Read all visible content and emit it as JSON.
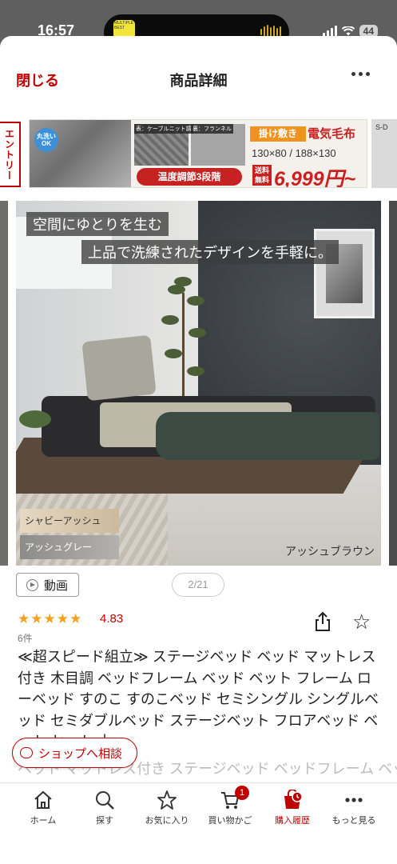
{
  "status_bar": {
    "time": "16:57",
    "battery": "44",
    "island_app_label": "MULTIPLE BEST"
  },
  "header": {
    "close_label": "閉じる",
    "title": "商品詳細"
  },
  "banner": {
    "entry_label": "エントリー",
    "wash_badge": "丸洗いOK",
    "tag_front": "表：ケーブルニット調",
    "tag_back": "裏：フランネル",
    "temp_label": "温度調節3段階",
    "heat_label": "掛け敷き",
    "product_label": "電気毛布",
    "size_label": "130×80 / 188×130",
    "free_shipping": "送料無料",
    "price": "6,999円~",
    "next_label": "S-D"
  },
  "hero": {
    "caption_line1": "空間にゆとりを生む",
    "caption_line2": "上品で洗練されたデザインを手軽に。",
    "swatch_1": "シャビーアッシュ",
    "swatch_2": "アッシュグレー",
    "color_name": "アッシュブラウン"
  },
  "media": {
    "video_label": "動画",
    "pager": "2/21"
  },
  "rating": {
    "stars": 5,
    "score": "4.83",
    "review_count": "6件"
  },
  "product": {
    "name": "≪超スピード組立≫ ステージベッド ベッド マットレス付き 木目調 ベッドフレーム ベッド ベット フレーム ローベッド すのこ すのこベッド セミシングル シングルベッド セミダブルベッド ステージベット フロアベッド ベット セット 木",
    "name_tail": "ベット マットレス付き ステージベッド ベッドフレーム ベット"
  },
  "consult_label": "ショップへ相談",
  "tabbar": {
    "home": "ホーム",
    "search": "探す",
    "favorites": "お気に入り",
    "cart": "買い物かご",
    "cart_badge": "1",
    "history": "購入履歴",
    "more": "もっと見る"
  },
  "colors": {
    "brand_red": "#bf0000",
    "star": "#f0a11e"
  }
}
